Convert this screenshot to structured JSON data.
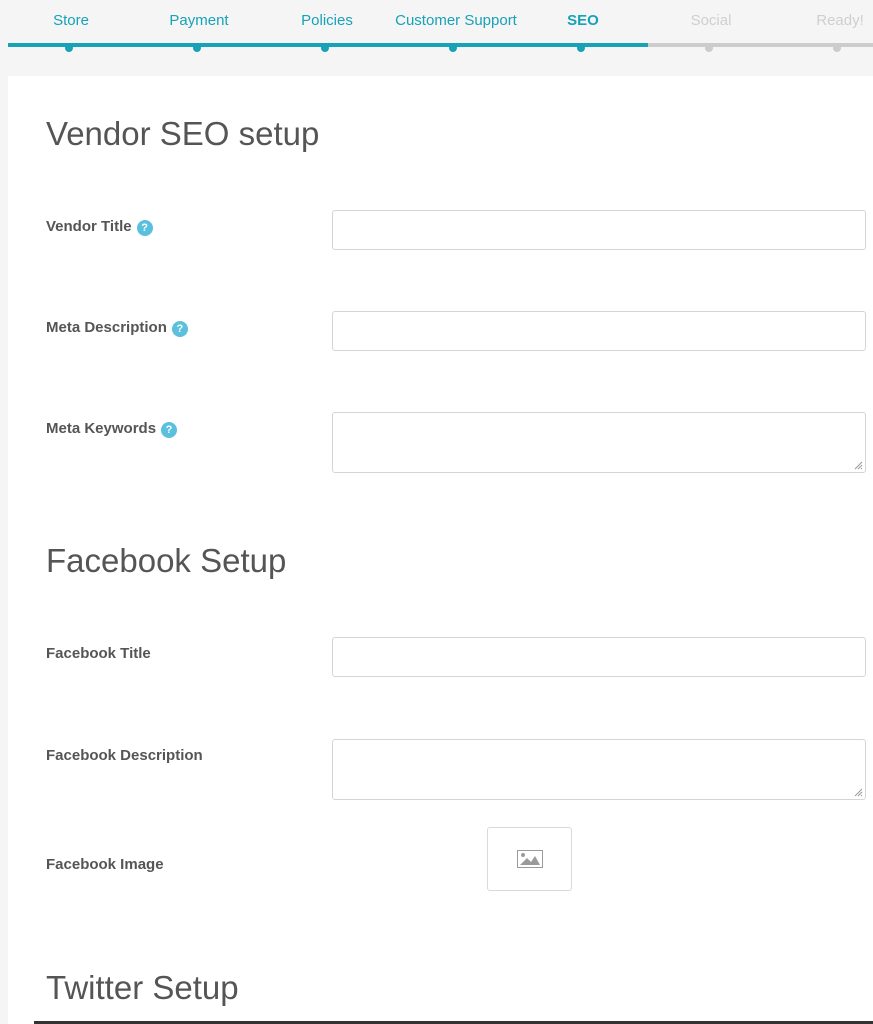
{
  "steps": [
    {
      "label": "Store",
      "state": "done"
    },
    {
      "label": "Payment",
      "state": "done"
    },
    {
      "label": "Policies",
      "state": "done"
    },
    {
      "label": "Customer Support",
      "state": "done"
    },
    {
      "label": "SEO",
      "state": "active"
    },
    {
      "label": "Social",
      "state": "todo"
    },
    {
      "label": "Ready!",
      "state": "todo"
    }
  ],
  "seo": {
    "title": "Vendor SEO setup",
    "vendor_title_label": "Vendor Title",
    "vendor_title_value": "",
    "meta_description_label": "Meta Description",
    "meta_description_value": "",
    "meta_keywords_label": "Meta Keywords",
    "meta_keywords_value": ""
  },
  "facebook": {
    "title": "Facebook Setup",
    "title_label": "Facebook Title",
    "title_value": "",
    "description_label": "Facebook Description",
    "description_value": "",
    "image_label": "Facebook Image",
    "image_icon": "image-icon"
  },
  "twitter": {
    "title": "Twitter Setup"
  },
  "icons": {
    "help": "?"
  },
  "colors": {
    "accent": "#17a2b8",
    "inactive": "#cccccc",
    "help": "#5bc0de"
  }
}
